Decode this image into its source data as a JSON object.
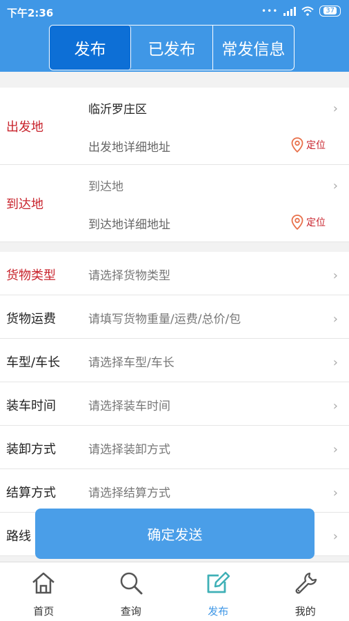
{
  "statusbar": {
    "time": "下午2:36",
    "dots": "•••",
    "battery": "37"
  },
  "tabs": [
    "发布",
    "已发布",
    "常发信息"
  ],
  "departure": {
    "label": "出发地",
    "value": "临沂罗庄区",
    "detail_placeholder": "出发地详细地址",
    "locate": "定位"
  },
  "arrival": {
    "label": "到达地",
    "placeholder": "到达地",
    "detail_placeholder": "到达地详细地址",
    "locate": "定位"
  },
  "form_rows": [
    {
      "label": "货物类型",
      "placeholder": "请选择货物类型",
      "required": true
    },
    {
      "label": "货物运费",
      "placeholder": "请填写货物重量/运费/总价/包",
      "required": false
    },
    {
      "label": "车型/车长",
      "placeholder": "请选择车型/车长",
      "required": false
    },
    {
      "label": "装车时间",
      "placeholder": "请选择装车时间",
      "required": false
    },
    {
      "label": "装卸方式",
      "placeholder": "请选择装卸方式",
      "required": false
    },
    {
      "label": "结算方式",
      "placeholder": "请选择结算方式",
      "required": false
    },
    {
      "label": "路线",
      "placeholder": "",
      "required": false
    }
  ],
  "send_button": "确定发送",
  "tabbar": [
    {
      "label": "首页",
      "icon": "home-icon"
    },
    {
      "label": "查询",
      "icon": "search-icon"
    },
    {
      "label": "发布",
      "icon": "edit-icon",
      "active": true
    },
    {
      "label": "我的",
      "icon": "wrench-icon"
    }
  ],
  "colors": {
    "primary": "#3f97e6",
    "active_tab": "#0d6fd6",
    "required": "#c8232c"
  }
}
